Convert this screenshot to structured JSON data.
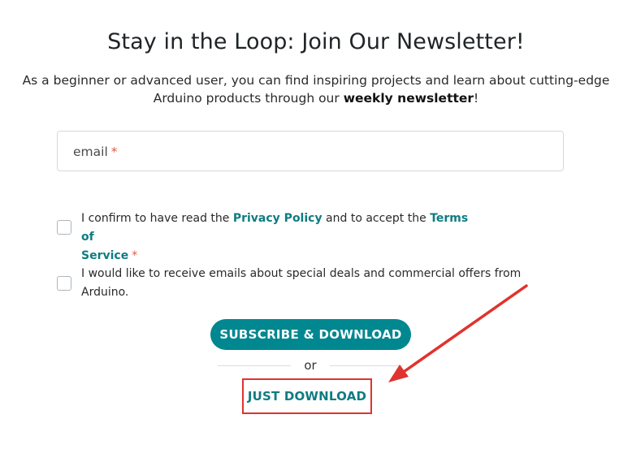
{
  "header": {
    "title": "Stay in the Loop: Join Our Newsletter!",
    "subtitle_part1": "As a beginner or advanced user, you can find inspiring projects and learn about cutting-edge Arduino products through our ",
    "subtitle_bold": "weekly newsletter",
    "subtitle_end": "!"
  },
  "form": {
    "email_placeholder": "email",
    "required_mark": "*",
    "consent_text_1": "I confirm to have read the ",
    "privacy_policy_link": "Privacy Policy",
    "consent_text_2": " and to accept the ",
    "terms_link_line1": "Terms of",
    "terms_link_line2": "Service",
    "offers_line1": "I would like to receive emails about special deals and commercial offers from",
    "offers_line2": "Arduino."
  },
  "actions": {
    "subscribe_label": "SUBSCRIBE & DOWNLOAD",
    "or_label": "or",
    "just_download_label": "JUST DOWNLOAD"
  },
  "colors": {
    "accent": "#00878f",
    "link": "#0e7c81",
    "required": "#da5b4a",
    "annotation": "#e0332f"
  }
}
